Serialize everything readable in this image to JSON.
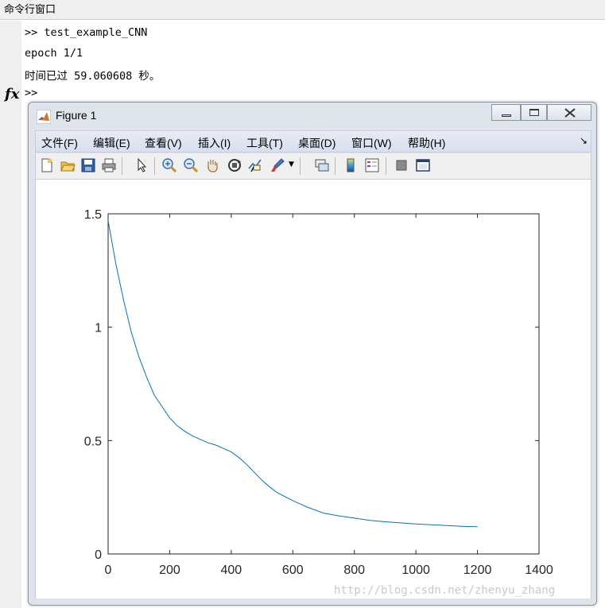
{
  "window": {
    "title": "命令行窗口"
  },
  "console": {
    "lines": [
      ">> test_example_CNN",
      "epoch 1/1",
      "时间已过 59.060608 秒。"
    ],
    "prompt": ">>",
    "fx_label": "fx"
  },
  "figure": {
    "title": "Figure 1",
    "menus": [
      "文件(F)",
      "编辑(E)",
      "查看(V)",
      "插入(I)",
      "工具(T)",
      "桌面(D)",
      "窗口(W)",
      "帮助(H)"
    ],
    "toolbar_icons": [
      "new-figure-icon",
      "open-file-icon",
      "save-icon",
      "print-icon",
      "edit-plot-arrow-icon",
      "zoom-in-icon",
      "zoom-out-icon",
      "pan-hand-icon",
      "rotate-3d-icon",
      "data-cursor-icon",
      "brush-icon",
      "link-plot-icon",
      "colorbar-icon",
      "legend-icon",
      "hide-plot-tools-icon",
      "show-plot-tools-icon"
    ]
  },
  "chart_data": {
    "type": "line",
    "title": "",
    "xlabel": "",
    "ylabel": "",
    "xlim": [
      0,
      1400
    ],
    "ylim": [
      0,
      1.5
    ],
    "xticks": [
      0,
      200,
      400,
      600,
      800,
      1000,
      1200,
      1400
    ],
    "yticks": [
      0,
      0.5,
      1,
      1.5
    ],
    "grid": false,
    "series": [
      {
        "color": "#0072bd",
        "x": [
          0,
          25,
          50,
          75,
          100,
          125,
          150,
          175,
          200,
          225,
          250,
          275,
          300,
          325,
          350,
          375,
          400,
          425,
          450,
          475,
          500,
          525,
          550,
          600,
          650,
          700,
          750,
          800,
          850,
          900,
          950,
          1000,
          1050,
          1100,
          1150,
          1200
        ],
        "y": [
          1.47,
          1.28,
          1.12,
          0.98,
          0.87,
          0.78,
          0.7,
          0.65,
          0.6,
          0.565,
          0.54,
          0.52,
          0.505,
          0.49,
          0.48,
          0.465,
          0.45,
          0.425,
          0.395,
          0.36,
          0.325,
          0.295,
          0.27,
          0.235,
          0.205,
          0.18,
          0.168,
          0.158,
          0.148,
          0.142,
          0.137,
          0.132,
          0.129,
          0.125,
          0.122,
          0.12
        ]
      }
    ]
  },
  "watermark": "http://blog.csdn.net/zhenyu_zhang"
}
